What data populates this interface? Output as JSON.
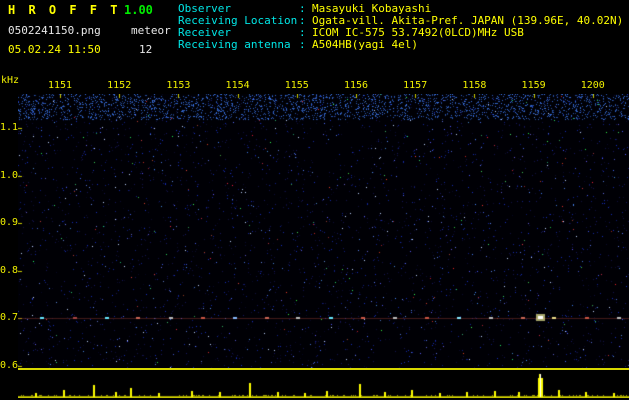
{
  "header": {
    "app_name": "H R O F F T",
    "version": "1.00",
    "filename": "0502241150.png",
    "mode": "meteor",
    "datetime": "05.02.24 11:50",
    "count": "12",
    "info_separator": ":",
    "info": [
      {
        "label": "Observer",
        "value": "Masayuki Kobayashi"
      },
      {
        "label": "Receiving Location",
        "value": "Ogata-vill. Akita-Pref. JAPAN (139.96E, 40.02N)"
      },
      {
        "label": "Receiver",
        "value": "ICOM IC-575 53.7492(0LCD)MHz USB"
      },
      {
        "label": "Receiving antenna",
        "value": "A504HB(yagi 4el)"
      }
    ]
  },
  "colors": {
    "title": "#ffff00",
    "version": "#00ee00",
    "info_label": "#00e6e6",
    "info_value": "#ffff00",
    "axis": "#f0f000",
    "background": "#000000",
    "noise_base": "#000040",
    "power_trace": "#ffff00"
  },
  "chart_data": {
    "type": "heatmap",
    "title": "HROFFT radio meteor echo spectrogram with signal power strip",
    "ylabel": "kHz",
    "y_ticks": [
      "1.1",
      "1.0",
      "0.9",
      "0.8",
      "0.7",
      "0.6"
    ],
    "y_range_khz": [
      0.58,
      1.17
    ],
    "x_ticks": [
      "1151",
      "1152",
      "1153",
      "1154",
      "1155",
      "1156",
      "1157",
      "1158",
      "1159",
      "1200"
    ],
    "x_unit": "time (HHMM)",
    "grid": false,
    "legend": false,
    "echo_track_khz": 0.7,
    "echo_marks": [
      {
        "t": 0.04,
        "color": "#66eaff"
      },
      {
        "t": 0.093,
        "color": "#aa4444"
      },
      {
        "t": 0.145,
        "color": "#66eaff"
      },
      {
        "t": 0.197,
        "color": "#cc6655"
      },
      {
        "t": 0.25,
        "color": "#bbbbbb"
      },
      {
        "t": 0.302,
        "color": "#cc5544"
      },
      {
        "t": 0.355,
        "color": "#88bbff"
      },
      {
        "t": 0.407,
        "color": "#cc6655"
      },
      {
        "t": 0.459,
        "color": "#bbbbbb"
      },
      {
        "t": 0.512,
        "color": "#66eaff"
      },
      {
        "t": 0.564,
        "color": "#cc5544"
      },
      {
        "t": 0.617,
        "color": "#bbbbbb"
      },
      {
        "t": 0.669,
        "color": "#cc5544"
      },
      {
        "t": 0.721,
        "color": "#88eaff"
      },
      {
        "t": 0.774,
        "color": "#bbbbbb"
      },
      {
        "t": 0.826,
        "color": "#cc6655"
      },
      {
        "t": 0.855,
        "color": "#ffffff",
        "bright": true
      },
      {
        "t": 0.878,
        "color": "#eedd88"
      },
      {
        "t": 0.931,
        "color": "#cc5544"
      },
      {
        "t": 0.983,
        "color": "#bbbbbb"
      }
    ],
    "power_spikes": [
      {
        "t": 0.03,
        "h": 0.18
      },
      {
        "t": 0.075,
        "h": 0.3
      },
      {
        "t": 0.125,
        "h": 0.5
      },
      {
        "t": 0.16,
        "h": 0.22
      },
      {
        "t": 0.185,
        "h": 0.38
      },
      {
        "t": 0.23,
        "h": 0.18
      },
      {
        "t": 0.285,
        "h": 0.25
      },
      {
        "t": 0.33,
        "h": 0.2
      },
      {
        "t": 0.38,
        "h": 0.6
      },
      {
        "t": 0.425,
        "h": 0.22
      },
      {
        "t": 0.47,
        "h": 0.18
      },
      {
        "t": 0.505,
        "h": 0.28
      },
      {
        "t": 0.56,
        "h": 0.55
      },
      {
        "t": 0.6,
        "h": 0.2
      },
      {
        "t": 0.645,
        "h": 0.3
      },
      {
        "t": 0.69,
        "h": 0.18
      },
      {
        "t": 0.735,
        "h": 0.22
      },
      {
        "t": 0.78,
        "h": 0.28
      },
      {
        "t": 0.82,
        "h": 0.2
      },
      {
        "t": 0.855,
        "h": 1.0
      },
      {
        "t": 0.885,
        "h": 0.32
      },
      {
        "t": 0.93,
        "h": 0.22
      },
      {
        "t": 0.975,
        "h": 0.16
      }
    ]
  }
}
